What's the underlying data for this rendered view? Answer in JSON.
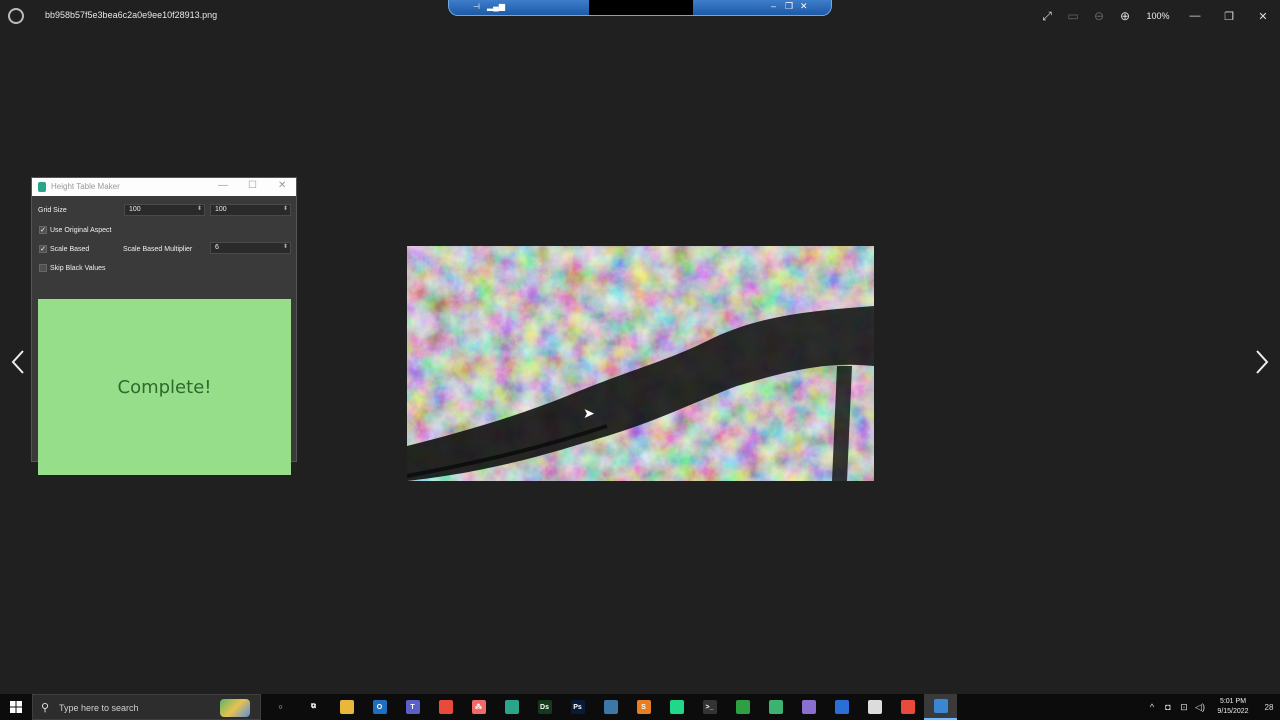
{
  "viewer": {
    "filename": "bb958b57f5e3bea6c2a0e9ee10f28913.png",
    "zoom": "100%",
    "tools": [
      "expand-icon",
      "slideshow-icon",
      "zoom-out-icon",
      "zoom-in-icon"
    ]
  },
  "rdp_bar": {
    "pin": "⊣",
    "signal": "▂▄▆"
  },
  "window": {
    "title": "Height Table Maker",
    "grid_size_label": "Grid Size",
    "grid_size_x": "100",
    "grid_size_y": "100",
    "use_original_aspect_label": "Use Original Aspect",
    "use_original_aspect_checked": true,
    "scale_based_label": "Scale Based",
    "scale_based_checked": true,
    "multiplier_label": "Scale Based Multiplier",
    "multiplier_value": "6",
    "skip_black_label": "Skip Black Values",
    "skip_black_checked": false,
    "status": "Complete!",
    "status_color": "#97de8a"
  },
  "taskbar": {
    "search_placeholder": "Type here to search",
    "apps": [
      {
        "name": "cortana",
        "glyph": "○",
        "color": "#0c0c0c"
      },
      {
        "name": "task-view",
        "glyph": "⧉",
        "color": "#0c0c0c"
      },
      {
        "name": "file-explorer",
        "glyph": "",
        "color": "#e8b83c"
      },
      {
        "name": "outlook",
        "glyph": "O",
        "color": "#1f6fc1"
      },
      {
        "name": "teams",
        "glyph": "T",
        "color": "#5b5fc7"
      },
      {
        "name": "chrome",
        "glyph": "",
        "color": "#e84a3c"
      },
      {
        "name": "asana",
        "glyph": "⁂",
        "color": "#f06a6a"
      },
      {
        "name": "height-table-maker",
        "glyph": "",
        "color": "#2ba58a"
      },
      {
        "name": "dimension",
        "glyph": "Ds",
        "color": "#143a1e"
      },
      {
        "name": "photoshop",
        "glyph": "Ps",
        "color": "#0a1b3a"
      },
      {
        "name": "python",
        "glyph": "",
        "color": "#3d77a8"
      },
      {
        "name": "sublime-text",
        "glyph": "S",
        "color": "#e67e22"
      },
      {
        "name": "pycharm",
        "glyph": "",
        "color": "#21d789"
      },
      {
        "name": "terminal",
        "glyph": ">_",
        "color": "#333"
      },
      {
        "name": "green-app",
        "glyph": "",
        "color": "#2ea043"
      },
      {
        "name": "monitor-app",
        "glyph": "",
        "color": "#3cb371"
      },
      {
        "name": "visual-studio",
        "glyph": "",
        "color": "#8a6fd1"
      },
      {
        "name": "outlook-2",
        "glyph": "",
        "color": "#2b6fd6"
      },
      {
        "name": "cloud-app",
        "glyph": "",
        "color": "#dcdcdc"
      },
      {
        "name": "chrome-2",
        "glyph": "",
        "color": "#e84a3c"
      },
      {
        "name": "photos",
        "glyph": "",
        "color": "#3a86d1"
      }
    ],
    "time": "5:01 PM",
    "date": "9/15/2022",
    "notifications": "28"
  }
}
